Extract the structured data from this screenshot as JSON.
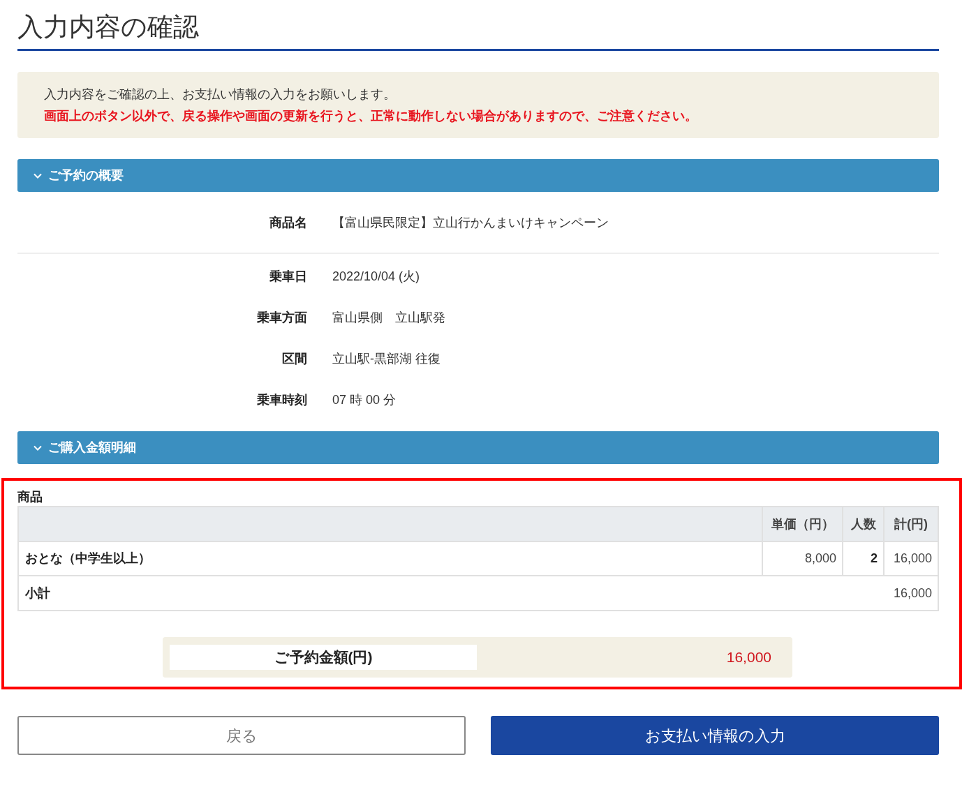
{
  "page_title": "入力内容の確認",
  "notice": {
    "message": "入力内容をご確認の上、お支払い情報の入力をお願いします。",
    "warning": "画面上のボタン以外で、戻る操作や画面の更新を行うと、正常に動作しない場合がありますので、ご注意ください。"
  },
  "summary": {
    "title": "ご予約の概要",
    "expanded": true,
    "field_groups": [
      {
        "fields": [
          {
            "label": "商品名",
            "value": "【富山県民限定】立山行かんまいけキャンペーン"
          }
        ]
      },
      {
        "fields": [
          {
            "label": "乗車日",
            "value": "2022/10/04 (火)"
          },
          {
            "label": "乗車方面",
            "value": "富山県側　立山駅発"
          },
          {
            "label": "区間",
            "value": "立山駅-黒部湖 往復"
          },
          {
            "label": "乗車時刻",
            "value": "07 時 00 分"
          }
        ]
      }
    ]
  },
  "breakdown": {
    "title": "ご購入金額明細",
    "expanded": true,
    "caption": "商品",
    "columns": [
      "単価（円）",
      "人数",
      "計(円)"
    ],
    "rows": [
      {
        "name": "おとな（中学生以上）",
        "unit_price": "8,000",
        "count": "2",
        "total": "16,000"
      }
    ],
    "subtotal": {
      "label": "小計",
      "value": "16,000"
    },
    "total": {
      "label": "ご予約金額(円)",
      "value": "16,000"
    }
  },
  "buttons": [
    {
      "kind": "secondary",
      "label": "戻る"
    },
    {
      "kind": "primary",
      "label": "お支払い情報の入力"
    }
  ]
}
